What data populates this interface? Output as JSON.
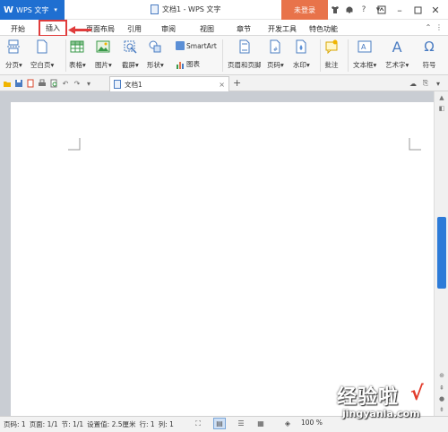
{
  "app": {
    "logo": "W",
    "name": "WPS 文字",
    "arrow": "▾"
  },
  "window": {
    "title": "文档1 - WPS 文字",
    "login": "未登录"
  },
  "title_icons": [
    "shirt-icon",
    "bell-icon",
    "help-icon",
    "settings-icon"
  ],
  "tabs": [
    {
      "label": "开始",
      "active": false
    },
    {
      "label": "插入",
      "active": true
    },
    {
      "label": "页面布局",
      "active": false
    },
    {
      "label": "引用",
      "active": false
    },
    {
      "label": "审阅",
      "active": false
    },
    {
      "label": "视图",
      "active": false
    },
    {
      "label": "章节",
      "active": false
    },
    {
      "label": "开发工具",
      "active": false
    },
    {
      "label": "特色功能",
      "active": false
    }
  ],
  "ribbon": {
    "fenye": "分页▾",
    "kongbaiye": "空白页▾",
    "biaoge": "表格▾",
    "tupian": "图片▾",
    "jieping": "截屏▾",
    "xingzhuang": "形状▾",
    "smartart": "SmartArt",
    "tubiao": "图表",
    "yemei": "页眉和页脚",
    "yema": "页码▾",
    "shuiyin": "水印▾",
    "pizhu": "批注",
    "wenbenkuang": "文本框▾",
    "yishuzi": "艺术字▾",
    "fuhao": "符号"
  },
  "document_tab": {
    "name": "文档1",
    "close": "×",
    "add": "+"
  },
  "status": {
    "page": "页码: 1",
    "pages": "页面: 1/1",
    "section": "节: 1/1",
    "setting": "设置值: 2.5厘米",
    "row": "行: 1",
    "col": "列: 1",
    "zoom": "100 %"
  },
  "watermark": {
    "title": "经验啦",
    "check": "√",
    "url": "jingyanla.com"
  },
  "colors": {
    "app_blue": "#1f6fd1",
    "login_orange": "#e8734a",
    "highlight_red": "#e03c3c",
    "scroll_blue": "#2d7bd8"
  }
}
